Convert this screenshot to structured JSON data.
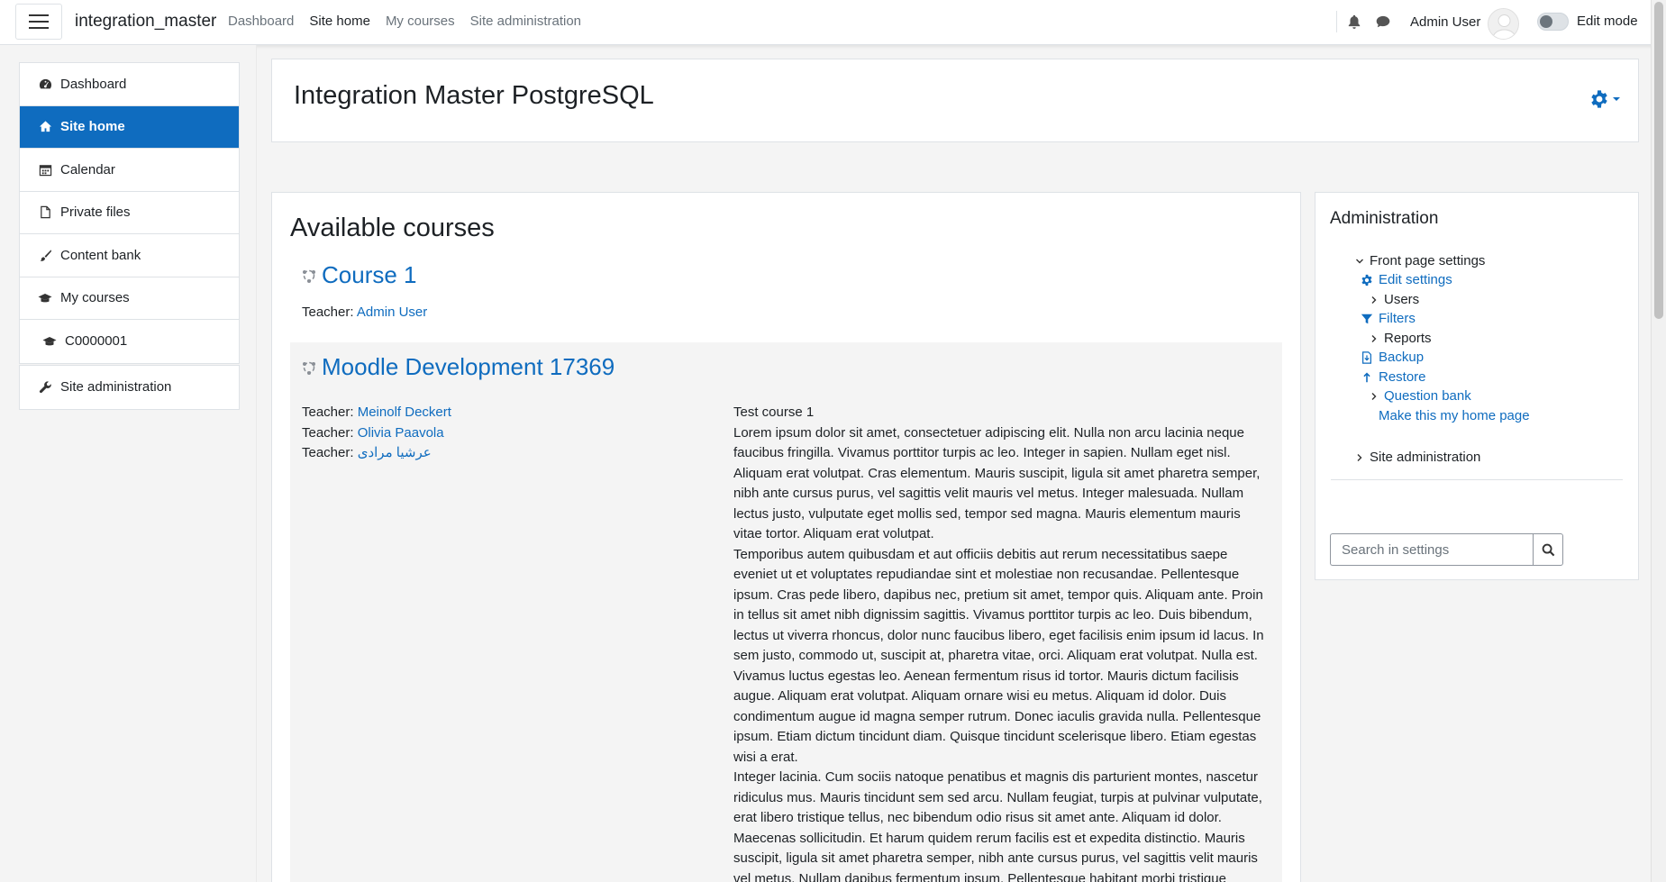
{
  "navbar": {
    "site_name": "integration_master",
    "links": [
      {
        "label": "Dashboard",
        "active": false
      },
      {
        "label": "Site home",
        "active": true
      },
      {
        "label": "My courses",
        "active": false
      },
      {
        "label": "Site administration",
        "active": false
      }
    ],
    "user_name": "Admin User",
    "edit_mode_label": "Edit mode",
    "edit_mode_on": false
  },
  "drawer": {
    "items": [
      {
        "label": "Dashboard",
        "icon": "dashboard-icon",
        "active": false
      },
      {
        "label": "Site home",
        "icon": "home-icon",
        "active": true
      },
      {
        "label": "Calendar",
        "icon": "calendar-icon",
        "active": false
      },
      {
        "label": "Private files",
        "icon": "file-icon",
        "active": false
      },
      {
        "label": "Content bank",
        "icon": "brush-icon",
        "active": false
      },
      {
        "label": "My courses",
        "icon": "graduation-cap-icon",
        "active": false
      },
      {
        "label": "C0000001",
        "icon": "graduation-cap-icon",
        "active": false
      }
    ],
    "admin_item": {
      "label": "Site administration",
      "icon": "wrench-icon"
    }
  },
  "header": {
    "title": "Integration Master PostgreSQL"
  },
  "main": {
    "heading": "Available courses",
    "courses": [
      {
        "title": "Course 1",
        "teachers": [
          {
            "label": "Teacher:",
            "name": "Admin User"
          }
        ]
      },
      {
        "title": "Moodle Development 17369",
        "teachers": [
          {
            "label": "Teacher:",
            "name": "Meinolf Deckert"
          },
          {
            "label": "Teacher:",
            "name": "Olivia Paavola"
          },
          {
            "label": "Teacher:",
            "name": "عرشیا مرادی"
          }
        ],
        "summary_title": "Test course 1",
        "summary_paragraphs": [
          "Lorem ipsum dolor sit amet, consectetuer adipiscing elit. Nulla non arcu lacinia neque faucibus fringilla. Vivamus porttitor turpis ac leo. Integer in sapien. Nullam eget nisl. Aliquam erat volutpat. Cras elementum. Mauris suscipit, ligula sit amet pharetra semper, nibh ante cursus purus, vel sagittis velit mauris vel metus. Integer malesuada. Nullam lectus justo, vulputate eget mollis sed, tempor sed magna. Mauris elementum mauris vitae tortor. Aliquam erat volutpat.",
          "Temporibus autem quibusdam et aut officiis debitis aut rerum necessitatibus saepe eveniet ut et voluptates repudiandae sint et molestiae non recusandae. Pellentesque ipsum. Cras pede libero, dapibus nec, pretium sit amet, tempor quis. Aliquam ante. Proin in tellus sit amet nibh dignissim sagittis. Vivamus porttitor turpis ac leo. Duis bibendum, lectus ut viverra rhoncus, dolor nunc faucibus libero, eget facilisis enim ipsum id lacus. In sem justo, commodo ut, suscipit at, pharetra vitae, orci. Aliquam erat volutpat. Nulla est. Vivamus luctus egestas leo. Aenean fermentum risus id tortor. Mauris dictum facilisis augue. Aliquam erat volutpat. Aliquam ornare wisi eu metus. Aliquam id dolor. Duis condimentum augue id magna semper rutrum. Donec iaculis gravida nulla. Pellentesque ipsum. Etiam dictum tincidunt diam. Quisque tincidunt scelerisque libero. Etiam egestas wisi a erat.",
          "Integer lacinia. Cum sociis natoque penatibus et magnis dis parturient montes, nascetur ridiculus mus. Mauris tincidunt sem sed arcu. Nullam feugiat, turpis at pulvinar vulputate, erat libero tristique tellus, nec bibendum odio risus sit amet ante. Aliquam id dolor. Maecenas sollicitudin. Et harum quidem rerum facilis est et expedita distinctio. Mauris suscipit, ligula sit amet pharetra semper, nibh ante cursus purus, vel sagittis velit mauris vel metus. Nullam dapibus fermentum ipsum. Pellentesque habitant morbi tristique"
        ]
      }
    ]
  },
  "admin_block": {
    "title": "Administration",
    "tree": [
      {
        "label": "Front page settings",
        "type": "expanded",
        "link": false
      },
      {
        "label": "Edit settings",
        "type": "gear",
        "link": true
      },
      {
        "label": "Users",
        "type": "collapsed",
        "link": false
      },
      {
        "label": "Filters",
        "type": "filter",
        "link": true
      },
      {
        "label": "Reports",
        "type": "collapsed",
        "link": false
      },
      {
        "label": "Backup",
        "type": "backup",
        "link": true
      },
      {
        "label": "Restore",
        "type": "restore",
        "link": true
      },
      {
        "label": "Question bank",
        "type": "collapsed",
        "link": true
      },
      {
        "label": "Make this my home page",
        "type": "none",
        "link": true
      },
      {
        "label": "Site administration",
        "type": "collapsed",
        "link": false
      }
    ],
    "search_placeholder": "Search in settings"
  },
  "colors": {
    "primary": "#0f6cbf",
    "text": "#1d2125",
    "muted": "#6a737b",
    "background": "#f4f4f4"
  }
}
